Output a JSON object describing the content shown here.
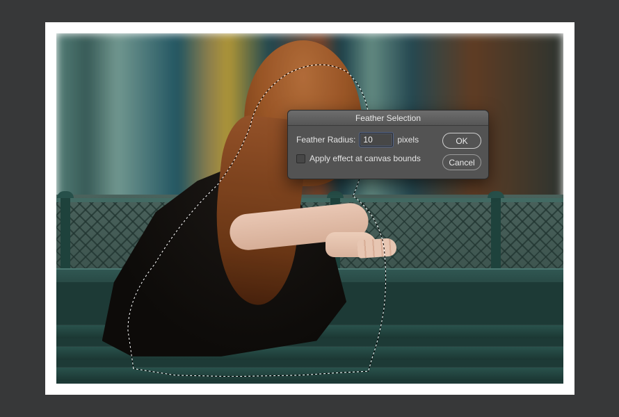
{
  "dialog": {
    "title": "Feather Selection",
    "radius_label": "Feather Radius:",
    "radius_value": "10",
    "radius_unit": "pixels",
    "apply_bounds_label": "Apply effect at canvas bounds",
    "apply_bounds_checked": false,
    "ok_label": "OK",
    "cancel_label": "Cancel"
  }
}
